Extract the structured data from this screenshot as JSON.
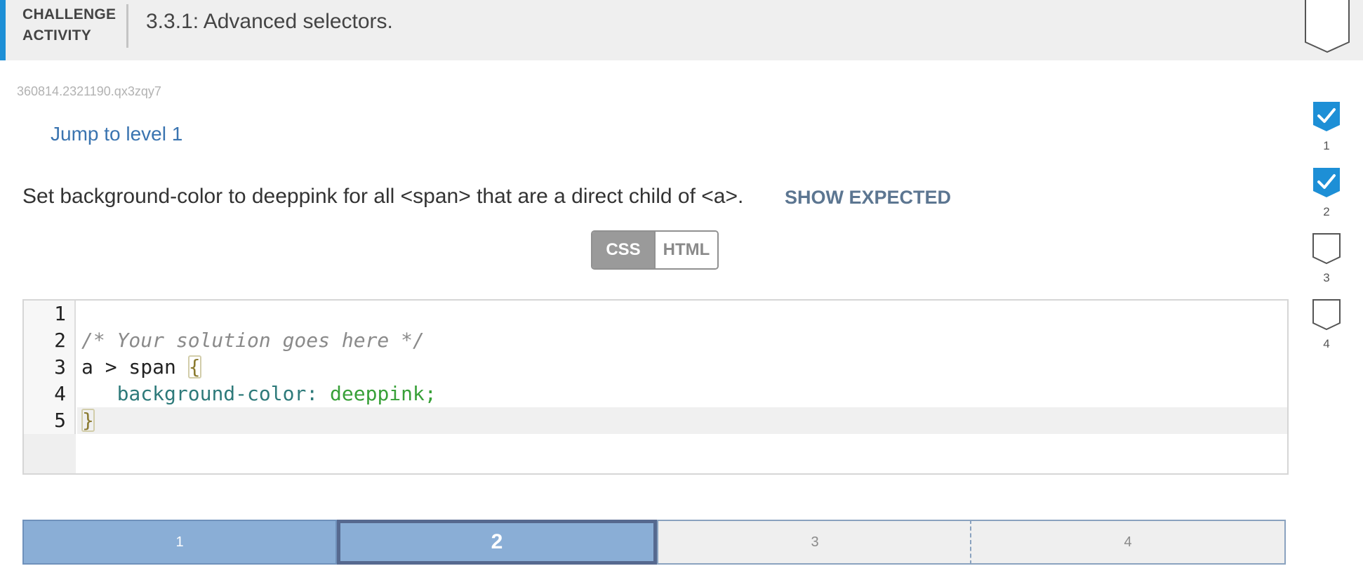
{
  "header": {
    "label_line1": "CHALLENGE",
    "label_line2": "ACTIVITY",
    "title": "3.3.1: Advanced selectors."
  },
  "activity_id": "360814.2321190.qx3zqy7",
  "jump_link": "Jump to level 1",
  "instruction": "Set background-color to deeppink for all <span> that are a direct child of <a>.",
  "show_expected": "SHOW EXPECTED",
  "toggle": {
    "css_label": "CSS",
    "html_label": "HTML",
    "selected": "CSS"
  },
  "editor": {
    "line_numbers": [
      "1",
      "2",
      "3",
      "4",
      "5"
    ],
    "lines": {
      "comment": "/* Your solution goes here */",
      "selector": "a > span ",
      "open_brace": "{",
      "indent": "   ",
      "property": "background-color:",
      "value": " deeppink;",
      "close_brace": "}"
    }
  },
  "levels": [
    {
      "label": "1",
      "state": "done"
    },
    {
      "label": "2",
      "state": "current"
    },
    {
      "label": "3",
      "state": "todo"
    },
    {
      "label": "4",
      "state": "todo"
    }
  ],
  "progress": [
    {
      "label": "1",
      "completed": true
    },
    {
      "label": "2",
      "completed": true
    },
    {
      "label": "3",
      "completed": false
    },
    {
      "label": "4",
      "completed": false
    }
  ],
  "colors": {
    "accent": "#1d8fd6",
    "level_done": "#8aaed6",
    "level_current_border": "#56698f",
    "link": "#3a74b0"
  }
}
